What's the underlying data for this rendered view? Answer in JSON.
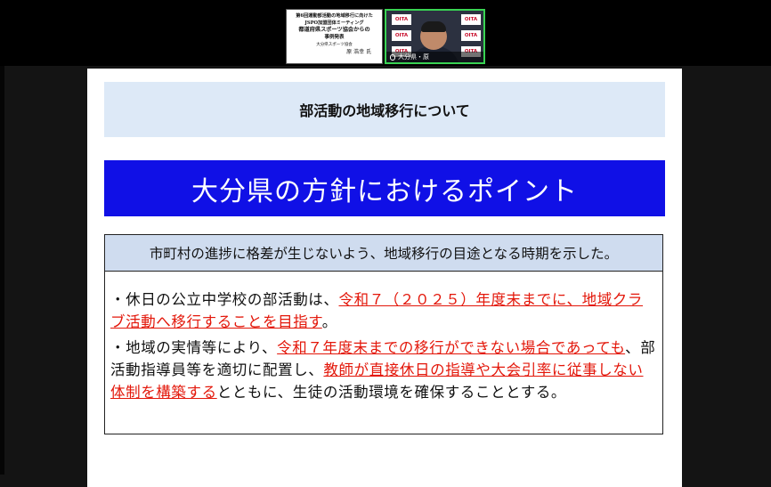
{
  "meeting": {
    "shared_slide_thumbnail": {
      "lines": [
        "第6回運動部活動の地域移行に向けた",
        "JSPO加盟団体ミーティング",
        "都道府県スポーツ協会からの",
        "事例発表",
        "大分県スポーツ協会",
        "原 浩幸 氏"
      ]
    },
    "video_tile": {
      "backdrop_logo": "OITA",
      "name_label": "大分県・原"
    }
  },
  "slide": {
    "heading": "部活動の地域移行について",
    "banner": "大分県の方針におけるポイント",
    "point_header": "市町村の進捗に格差が生じないよう、地域移行の目途となる時期を示した。",
    "bullets": [
      {
        "prefix": "・休日の公立中学校の部活動は、",
        "highlight1": "令和７（２０２５）年度末までに、地域クラブ活動へ移行することを目指す",
        "suffix": "。"
      },
      {
        "prefix": "・地域の実情等により、",
        "highlight1": "令和７年度末までの移行ができない場合であっても",
        "middle": "、部活動指導員等を適切に配置し、",
        "highlight2": "教師が直接休日の指導や大会引率に従事しない体制を構築する",
        "suffix": "とともに、生徒の活動環境を確保することとする。"
      }
    ]
  },
  "colors": {
    "banner_bg": "#1010e6",
    "heading_bg": "#dde9f7",
    "highlight_red": "#e3170a",
    "active_speaker_border": "#39d353"
  }
}
